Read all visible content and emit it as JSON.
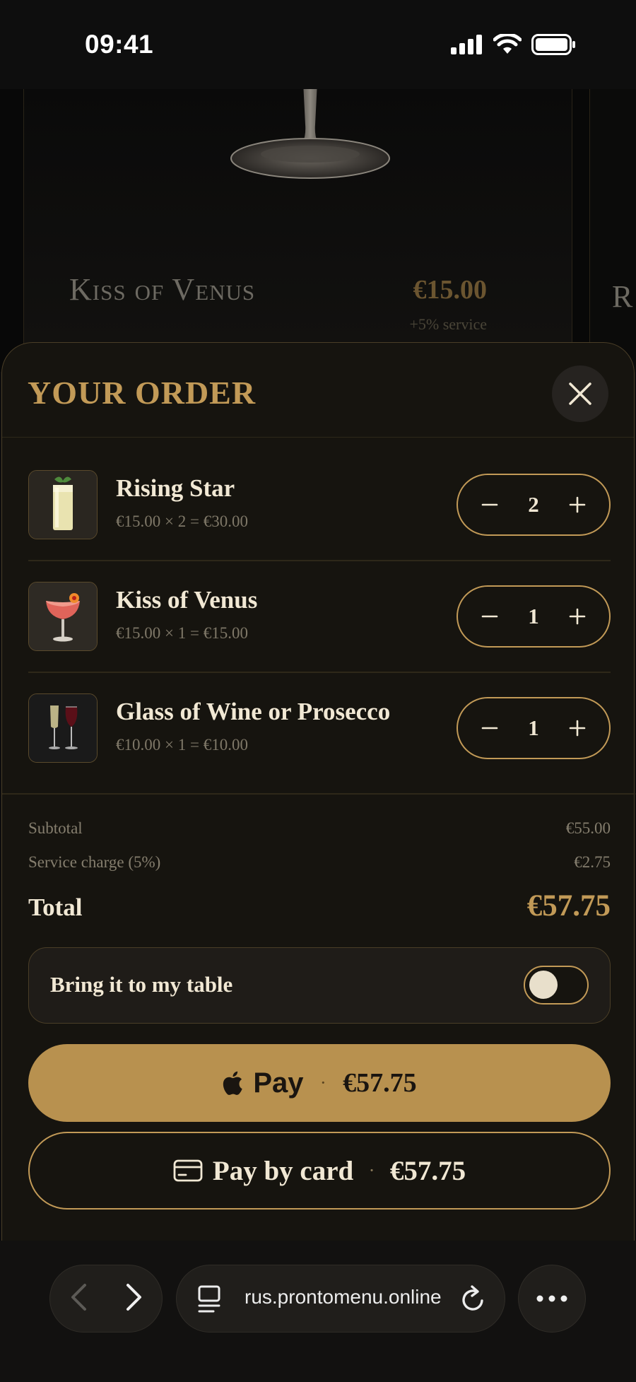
{
  "status_bar": {
    "time": "09:41"
  },
  "background_menu": {
    "item_title": "Kiss of Venus",
    "item_price": "€15.00",
    "item_service": "+5% service",
    "next_item_title_fragment": "R"
  },
  "order": {
    "title": "YOUR ORDER",
    "items": [
      {
        "name": "Rising Star",
        "calc": "€15.00 × 2 = €30.00",
        "qty": "2",
        "thumb_icon": "cocktail-highball-icon"
      },
      {
        "name": "Kiss of Venus",
        "calc": "€15.00 × 1 = €15.00",
        "qty": "1",
        "thumb_icon": "cocktail-coupe-icon"
      },
      {
        "name": "Glass of Wine or Prosecco",
        "calc": "€10.00 × 1 = €10.00",
        "qty": "1",
        "thumb_icon": "wine-glasses-icon"
      }
    ],
    "subtotal_label": "Subtotal",
    "subtotal_value": "€55.00",
    "service_label": "Service charge (5%)",
    "service_value": "€2.75",
    "total_label": "Total",
    "total_value": "€57.75",
    "table_service_label": "Bring it to my table",
    "table_service_enabled": false,
    "apple_pay_label": "Pay",
    "apple_pay_amount": "€57.75",
    "card_pay_label": "Pay by card",
    "card_pay_amount": "€57.75",
    "separator": "·"
  },
  "browser": {
    "url": "rus.prontomenu.online"
  },
  "colors": {
    "accent_gold": "#c29a57",
    "pay_button": "#b8914f",
    "sheet_bg": "#16140f",
    "text_light": "#f1e8d4"
  }
}
